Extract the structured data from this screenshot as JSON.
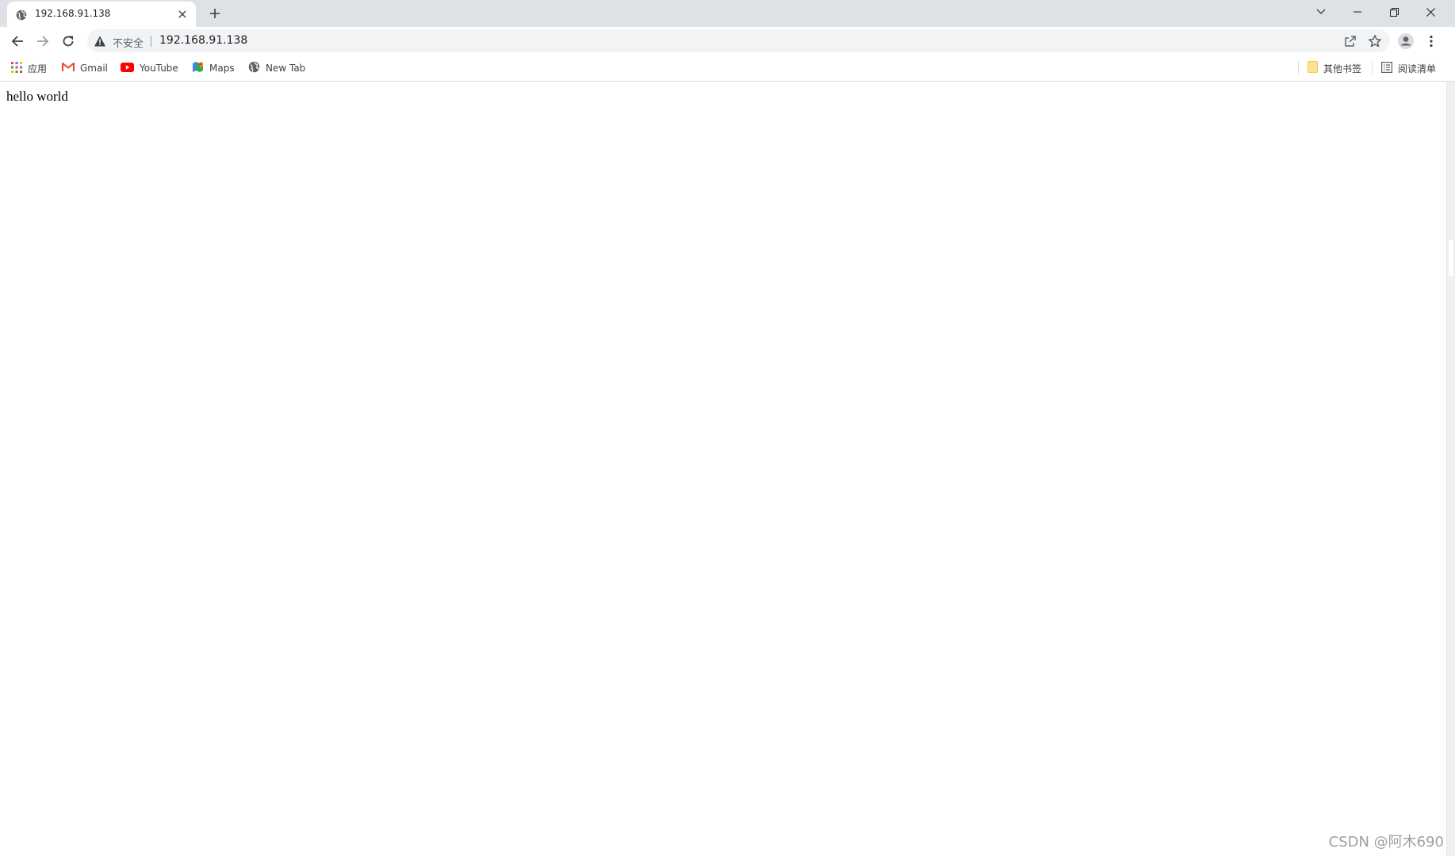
{
  "tab": {
    "title": "192.168.91.138",
    "favicon": "globe-icon"
  },
  "omnibox": {
    "security_label": "不安全",
    "url": "192.168.91.138"
  },
  "bookmarks": {
    "apps_label": "应用",
    "items": [
      {
        "label": "Gmail",
        "icon": "gmail-icon"
      },
      {
        "label": "YouTube",
        "icon": "youtube-icon"
      },
      {
        "label": "Maps",
        "icon": "maps-icon"
      },
      {
        "label": "New Tab",
        "icon": "globe-icon"
      }
    ],
    "other_label": "其他书签",
    "reading_list_label": "阅读清单"
  },
  "page": {
    "text": "hello world"
  },
  "watermark": "CSDN @阿木690",
  "colors": {
    "tabstrip": "#dee1e6",
    "omnibox": "#f1f3f4",
    "youtube": "#ff0000",
    "folder": "#fbd85d"
  }
}
